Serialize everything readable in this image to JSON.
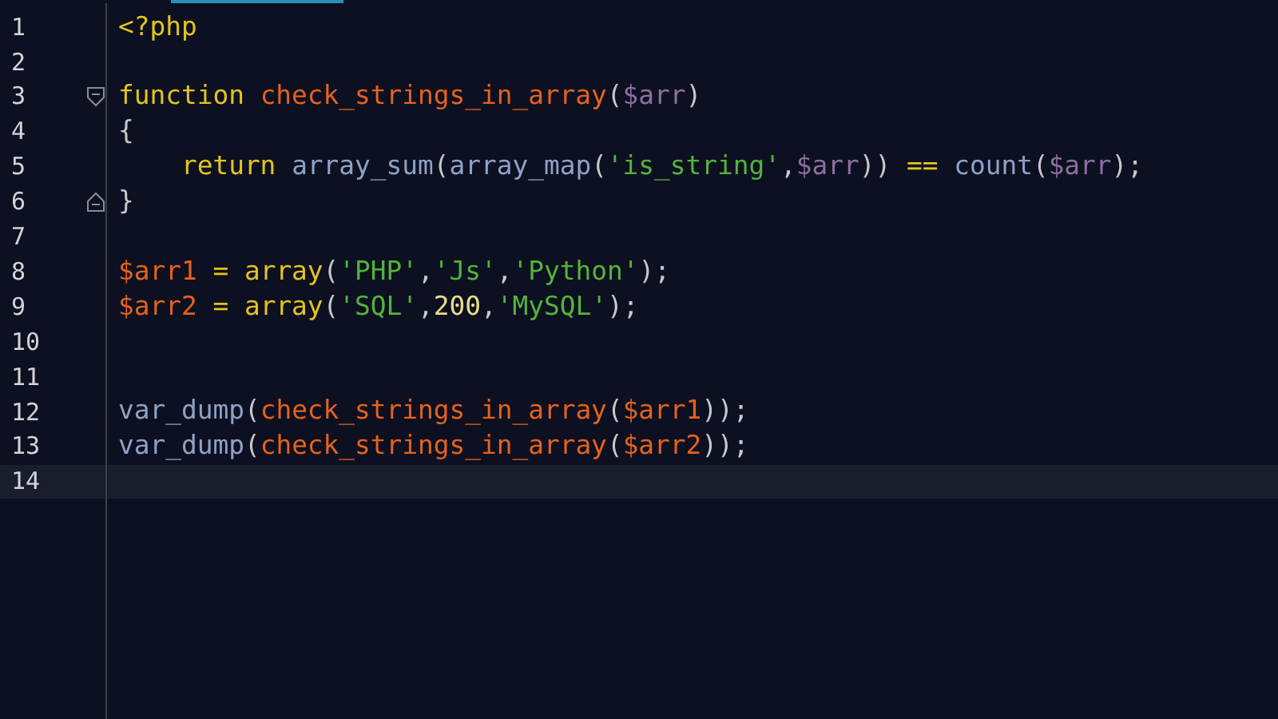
{
  "editor": {
    "lines": [
      {
        "number": "1",
        "current": false,
        "tokens": [
          {
            "text": "<?php",
            "kind": "keyword"
          }
        ]
      },
      {
        "number": "2",
        "current": false
      },
      {
        "number": "3",
        "current": false,
        "kind": "fold-start",
        "tokens": [
          {
            "text": "function ",
            "kind": "keyword"
          },
          {
            "text": "check_strings_in_array",
            "kind": "func"
          },
          {
            "text": "(",
            "kind": "punct"
          },
          {
            "text": "$arr",
            "kind": "param"
          },
          {
            "text": ")",
            "kind": "punct"
          }
        ]
      },
      {
        "number": "4",
        "current": false,
        "tokens": [
          {
            "text": "{",
            "kind": "punct"
          }
        ]
      },
      {
        "number": "5",
        "current": false,
        "tokens": [
          {
            "text": "    return ",
            "kind": "keyword"
          },
          {
            "text": "array_sum",
            "kind": "builtin"
          },
          {
            "text": "(",
            "kind": "punct"
          },
          {
            "text": "array_map",
            "kind": "builtin"
          },
          {
            "text": "(",
            "kind": "punct"
          },
          {
            "text": "'is_string'",
            "kind": "string"
          },
          {
            "text": ",",
            "kind": "punct"
          },
          {
            "text": "$arr",
            "kind": "param"
          },
          {
            "text": "))",
            "kind": "punct"
          },
          {
            "text": " == ",
            "kind": "keyword"
          },
          {
            "text": "count",
            "kind": "builtin"
          },
          {
            "text": "(",
            "kind": "punct"
          },
          {
            "text": "$arr",
            "kind": "param"
          },
          {
            "text": ");",
            "kind": "punct"
          }
        ]
      },
      {
        "number": "6",
        "current": false,
        "kind": "fold-end",
        "tokens": [
          {
            "text": "}",
            "kind": "punct"
          }
        ]
      },
      {
        "number": "7",
        "current": false
      },
      {
        "number": "8",
        "current": false,
        "tokens": [
          {
            "text": "$arr1",
            "kind": "variable"
          },
          {
            "text": " = ",
            "kind": "keyword"
          },
          {
            "text": "array",
            "kind": "keyword"
          },
          {
            "text": "(",
            "kind": "punct"
          },
          {
            "text": "'PHP'",
            "kind": "string"
          },
          {
            "text": ",",
            "kind": "punct"
          },
          {
            "text": "'Js'",
            "kind": "string"
          },
          {
            "text": ",",
            "kind": "punct"
          },
          {
            "text": "'Python'",
            "kind": "string"
          },
          {
            "text": ");",
            "kind": "punct"
          }
        ]
      },
      {
        "number": "9",
        "current": false,
        "tokens": [
          {
            "text": "$arr2",
            "kind": "variable"
          },
          {
            "text": " = ",
            "kind": "keyword"
          },
          {
            "text": "array",
            "kind": "keyword"
          },
          {
            "text": "(",
            "kind": "punct"
          },
          {
            "text": "'SQL'",
            "kind": "string"
          },
          {
            "text": ",",
            "kind": "punct"
          },
          {
            "text": "200",
            "kind": "number"
          },
          {
            "text": ",",
            "kind": "punct"
          },
          {
            "text": "'MySQL'",
            "kind": "string"
          },
          {
            "text": ");",
            "kind": "punct"
          }
        ]
      },
      {
        "number": "10",
        "current": false
      },
      {
        "number": "11",
        "current": false
      },
      {
        "number": "12",
        "current": false,
        "tokens": [
          {
            "text": "var_dump",
            "kind": "builtin"
          },
          {
            "text": "(",
            "kind": "punct"
          },
          {
            "text": "check_strings_in_array",
            "kind": "func"
          },
          {
            "text": "(",
            "kind": "punct"
          },
          {
            "text": "$arr1",
            "kind": "variable"
          },
          {
            "text": "));",
            "kind": "punct"
          }
        ]
      },
      {
        "number": "13",
        "current": false,
        "tokens": [
          {
            "text": "var_dump",
            "kind": "builtin"
          },
          {
            "text": "(",
            "kind": "punct"
          },
          {
            "text": "check_strings_in_array",
            "kind": "func"
          },
          {
            "text": "(",
            "kind": "punct"
          },
          {
            "text": "$arr2",
            "kind": "variable"
          },
          {
            "text": "));",
            "kind": "punct"
          }
        ]
      },
      {
        "number": "14",
        "current": true
      }
    ]
  }
}
